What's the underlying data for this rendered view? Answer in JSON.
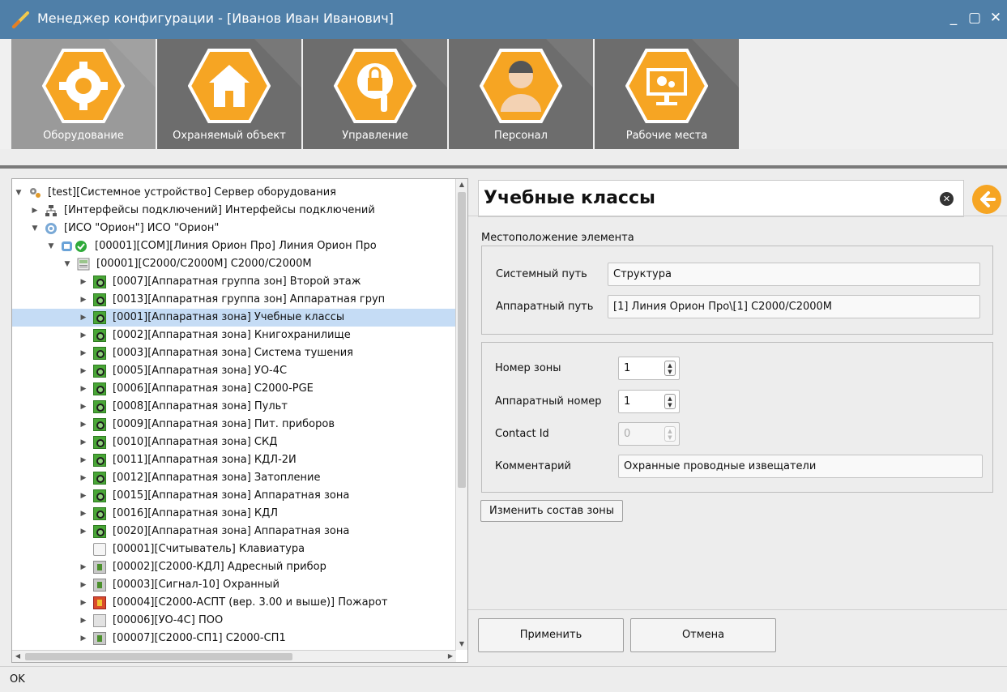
{
  "window": {
    "title": "Менеджер конфигурации - [Иванов Иван Иванович]",
    "minimize": "_",
    "maximize": "▢",
    "close": "✕"
  },
  "ribbon": {
    "items": [
      {
        "label": "Оборудование",
        "icon": "gear-icon",
        "active": true
      },
      {
        "label": "Охраняемый объект",
        "icon": "house-icon",
        "active": false
      },
      {
        "label": "Управление",
        "icon": "lock-gear-icon",
        "active": false
      },
      {
        "label": "Персонал",
        "icon": "person-icon",
        "active": false
      },
      {
        "label": "Рабочие места",
        "icon": "monitor-icon",
        "active": false
      }
    ]
  },
  "tree": {
    "rows": [
      {
        "text": "[test][Системное устройство] Сервер оборудования",
        "level": 0,
        "expanded": true,
        "icon": "gears-icon"
      },
      {
        "text": "[Интерфейсы подключений] Интерфейсы подключений",
        "level": 1,
        "expanded": false,
        "icon": "network-icon"
      },
      {
        "text": "[ИСО \"Орион\"] ИСО \"Орион\"",
        "level": 1,
        "expanded": true,
        "icon": "orion-icon"
      },
      {
        "text": "[00001][COM][Линия Орион Про] Линия Орион Про",
        "level": 2,
        "expanded": true,
        "icon": "com-line-icon"
      },
      {
        "text": "[00001][С2000/С2000М] С2000/С2000М",
        "level": 3,
        "expanded": true,
        "icon": "controller-icon"
      },
      {
        "text": "[0007][Аппаратная группа зон] Второй этаж",
        "level": 4,
        "expanded": false,
        "icon": "zone-group-icon"
      },
      {
        "text": "[0013][Аппаратная группа зон] Аппаратная груп",
        "level": 4,
        "expanded": false,
        "icon": "zone-group-icon"
      },
      {
        "text": "[0001][Аппаратная зона] Учебные классы",
        "level": 4,
        "expanded": false,
        "icon": "zone-icon",
        "selected": true
      },
      {
        "text": "[0002][Аппаратная зона] Книгохранилище",
        "level": 4,
        "expanded": false,
        "icon": "zone-icon"
      },
      {
        "text": "[0003][Аппаратная зона] Система тушения",
        "level": 4,
        "expanded": false,
        "icon": "zone-icon"
      },
      {
        "text": "[0005][Аппаратная зона] УО-4С",
        "level": 4,
        "expanded": false,
        "icon": "zone-icon"
      },
      {
        "text": "[0006][Аппаратная зона] С2000-PGE",
        "level": 4,
        "expanded": false,
        "icon": "zone-icon"
      },
      {
        "text": "[0008][Аппаратная зона] Пульт",
        "level": 4,
        "expanded": false,
        "icon": "zone-icon"
      },
      {
        "text": "[0009][Аппаратная зона] Пит. приборов",
        "level": 4,
        "expanded": false,
        "icon": "zone-icon"
      },
      {
        "text": "[0010][Аппаратная зона] СКД",
        "level": 4,
        "expanded": false,
        "icon": "zone-icon"
      },
      {
        "text": "[0011][Аппаратная зона] КДЛ-2И",
        "level": 4,
        "expanded": false,
        "icon": "zone-icon"
      },
      {
        "text": "[0012][Аппаратная зона] Затопление",
        "level": 4,
        "expanded": false,
        "icon": "zone-icon"
      },
      {
        "text": "[0015][Аппаратная зона] Аппаратная зона",
        "level": 4,
        "expanded": false,
        "icon": "zone-icon"
      },
      {
        "text": "[0016][Аппаратная зона] КДЛ",
        "level": 4,
        "expanded": false,
        "icon": "zone-icon"
      },
      {
        "text": "[0020][Аппаратная зона] Аппаратная зона",
        "level": 4,
        "expanded": false,
        "icon": "zone-icon"
      },
      {
        "text": "[00001][Считыватель] Клавиатура",
        "level": 4,
        "expanded": null,
        "icon": "reader-icon"
      },
      {
        "text": "[00002][С2000-КДЛ] Адресный прибор",
        "level": 4,
        "expanded": false,
        "icon": "device-icon"
      },
      {
        "text": "[00003][Сигнал-10] Охранный",
        "level": 4,
        "expanded": false,
        "icon": "device-icon"
      },
      {
        "text": "[00004][С2000-АСПТ (вер. 3.00 и выше)] Пожарот",
        "level": 4,
        "expanded": false,
        "icon": "fire-device-icon"
      },
      {
        "text": "[00006][УО-4С] ПОО",
        "level": 4,
        "expanded": false,
        "icon": "module-icon"
      },
      {
        "text": "[00007][С2000-СП1] С2000-СП1",
        "level": 4,
        "expanded": false,
        "icon": "device-icon"
      }
    ]
  },
  "details": {
    "name": "Учебные классы",
    "clear_icon": "✕",
    "location_title": "Местоположение элемента",
    "system_path_label": "Системный путь",
    "system_path_value": "Структура",
    "hw_path_label": "Аппаратный путь",
    "hw_path_value": "[1] Линия Орион Про\\[1] С2000/С2000М",
    "zone_number_label": "Номер зоны",
    "zone_number_value": "1",
    "hw_number_label": "Аппаратный номер",
    "hw_number_value": "1",
    "contact_id_label": "Contact Id",
    "contact_id_value": "0",
    "comment_label": "Комментарий",
    "comment_value": "Охранные  проводные извещатели",
    "change_zone_button": "Изменить состав зоны",
    "apply_button": "Применить",
    "cancel_button": "Отмена"
  },
  "status": {
    "text": "OK"
  },
  "colors": {
    "titlebar": "#4f7fa8",
    "ribbon_button": "#6d6d6d",
    "ribbon_active": "#9a9a9a",
    "accent_orange": "#f6a523",
    "selected_row": "#c5dcf5"
  }
}
